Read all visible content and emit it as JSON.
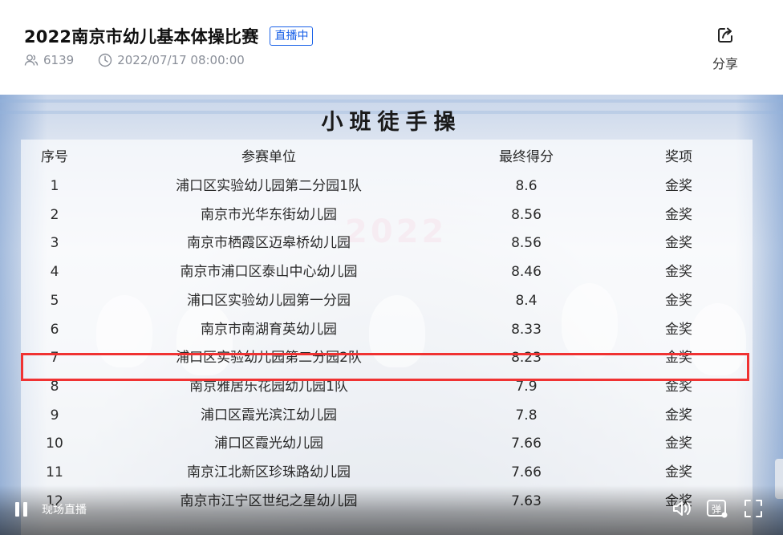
{
  "header": {
    "title": "2022南京市幼儿基本体操比赛",
    "badge": "直播中",
    "viewer_count": "6139",
    "datetime": "2022/07/17 08:00:00",
    "share_label": "分享"
  },
  "video": {
    "board_title": "小班徒手操",
    "background_text": "2022",
    "columns": [
      "序号",
      "参赛单位",
      "最终得分",
      "奖项"
    ],
    "rows": [
      {
        "idx": "1",
        "unit": "浦口区实验幼儿园第二分园1队",
        "score": "8.6",
        "award": "金奖"
      },
      {
        "idx": "2",
        "unit": "南京市光华东街幼儿园",
        "score": "8.56",
        "award": "金奖"
      },
      {
        "idx": "3",
        "unit": "南京市栖霞区迈皋桥幼儿园",
        "score": "8.56",
        "award": "金奖"
      },
      {
        "idx": "4",
        "unit": "南京市浦口区泰山中心幼儿园",
        "score": "8.46",
        "award": "金奖"
      },
      {
        "idx": "5",
        "unit": "浦口区实验幼儿园第一分园",
        "score": "8.4",
        "award": "金奖"
      },
      {
        "idx": "6",
        "unit": "南京市南湖育英幼儿园",
        "score": "8.33",
        "award": "金奖"
      },
      {
        "idx": "7",
        "unit": "浦口区实验幼儿园第二分园2队",
        "score": "8.23",
        "award": "金奖"
      },
      {
        "idx": "8",
        "unit": "南京雅居乐花园幼儿园1队",
        "score": "7.9",
        "award": "金奖"
      },
      {
        "idx": "9",
        "unit": "浦口区霞光滨江幼儿园",
        "score": "7.8",
        "award": "金奖"
      },
      {
        "idx": "10",
        "unit": "浦口区霞光幼儿园",
        "score": "7.66",
        "award": "金奖"
      },
      {
        "idx": "11",
        "unit": "南京江北新区珍珠路幼儿园",
        "score": "7.66",
        "award": "金奖"
      },
      {
        "idx": "12",
        "unit": "南京市江宁区世纪之星幼儿园",
        "score": "7.63",
        "award": "金奖"
      }
    ],
    "highlight_color": "#f03232"
  },
  "controls": {
    "live_label": "现场直播",
    "danmu_label": "弹"
  },
  "icons": {
    "viewers": "people-icon",
    "time": "clock-icon",
    "share": "share-icon",
    "pause": "pause-icon",
    "volume": "volume-icon",
    "danmu": "danmu-icon",
    "fullscreen": "fullscreen-icon"
  }
}
